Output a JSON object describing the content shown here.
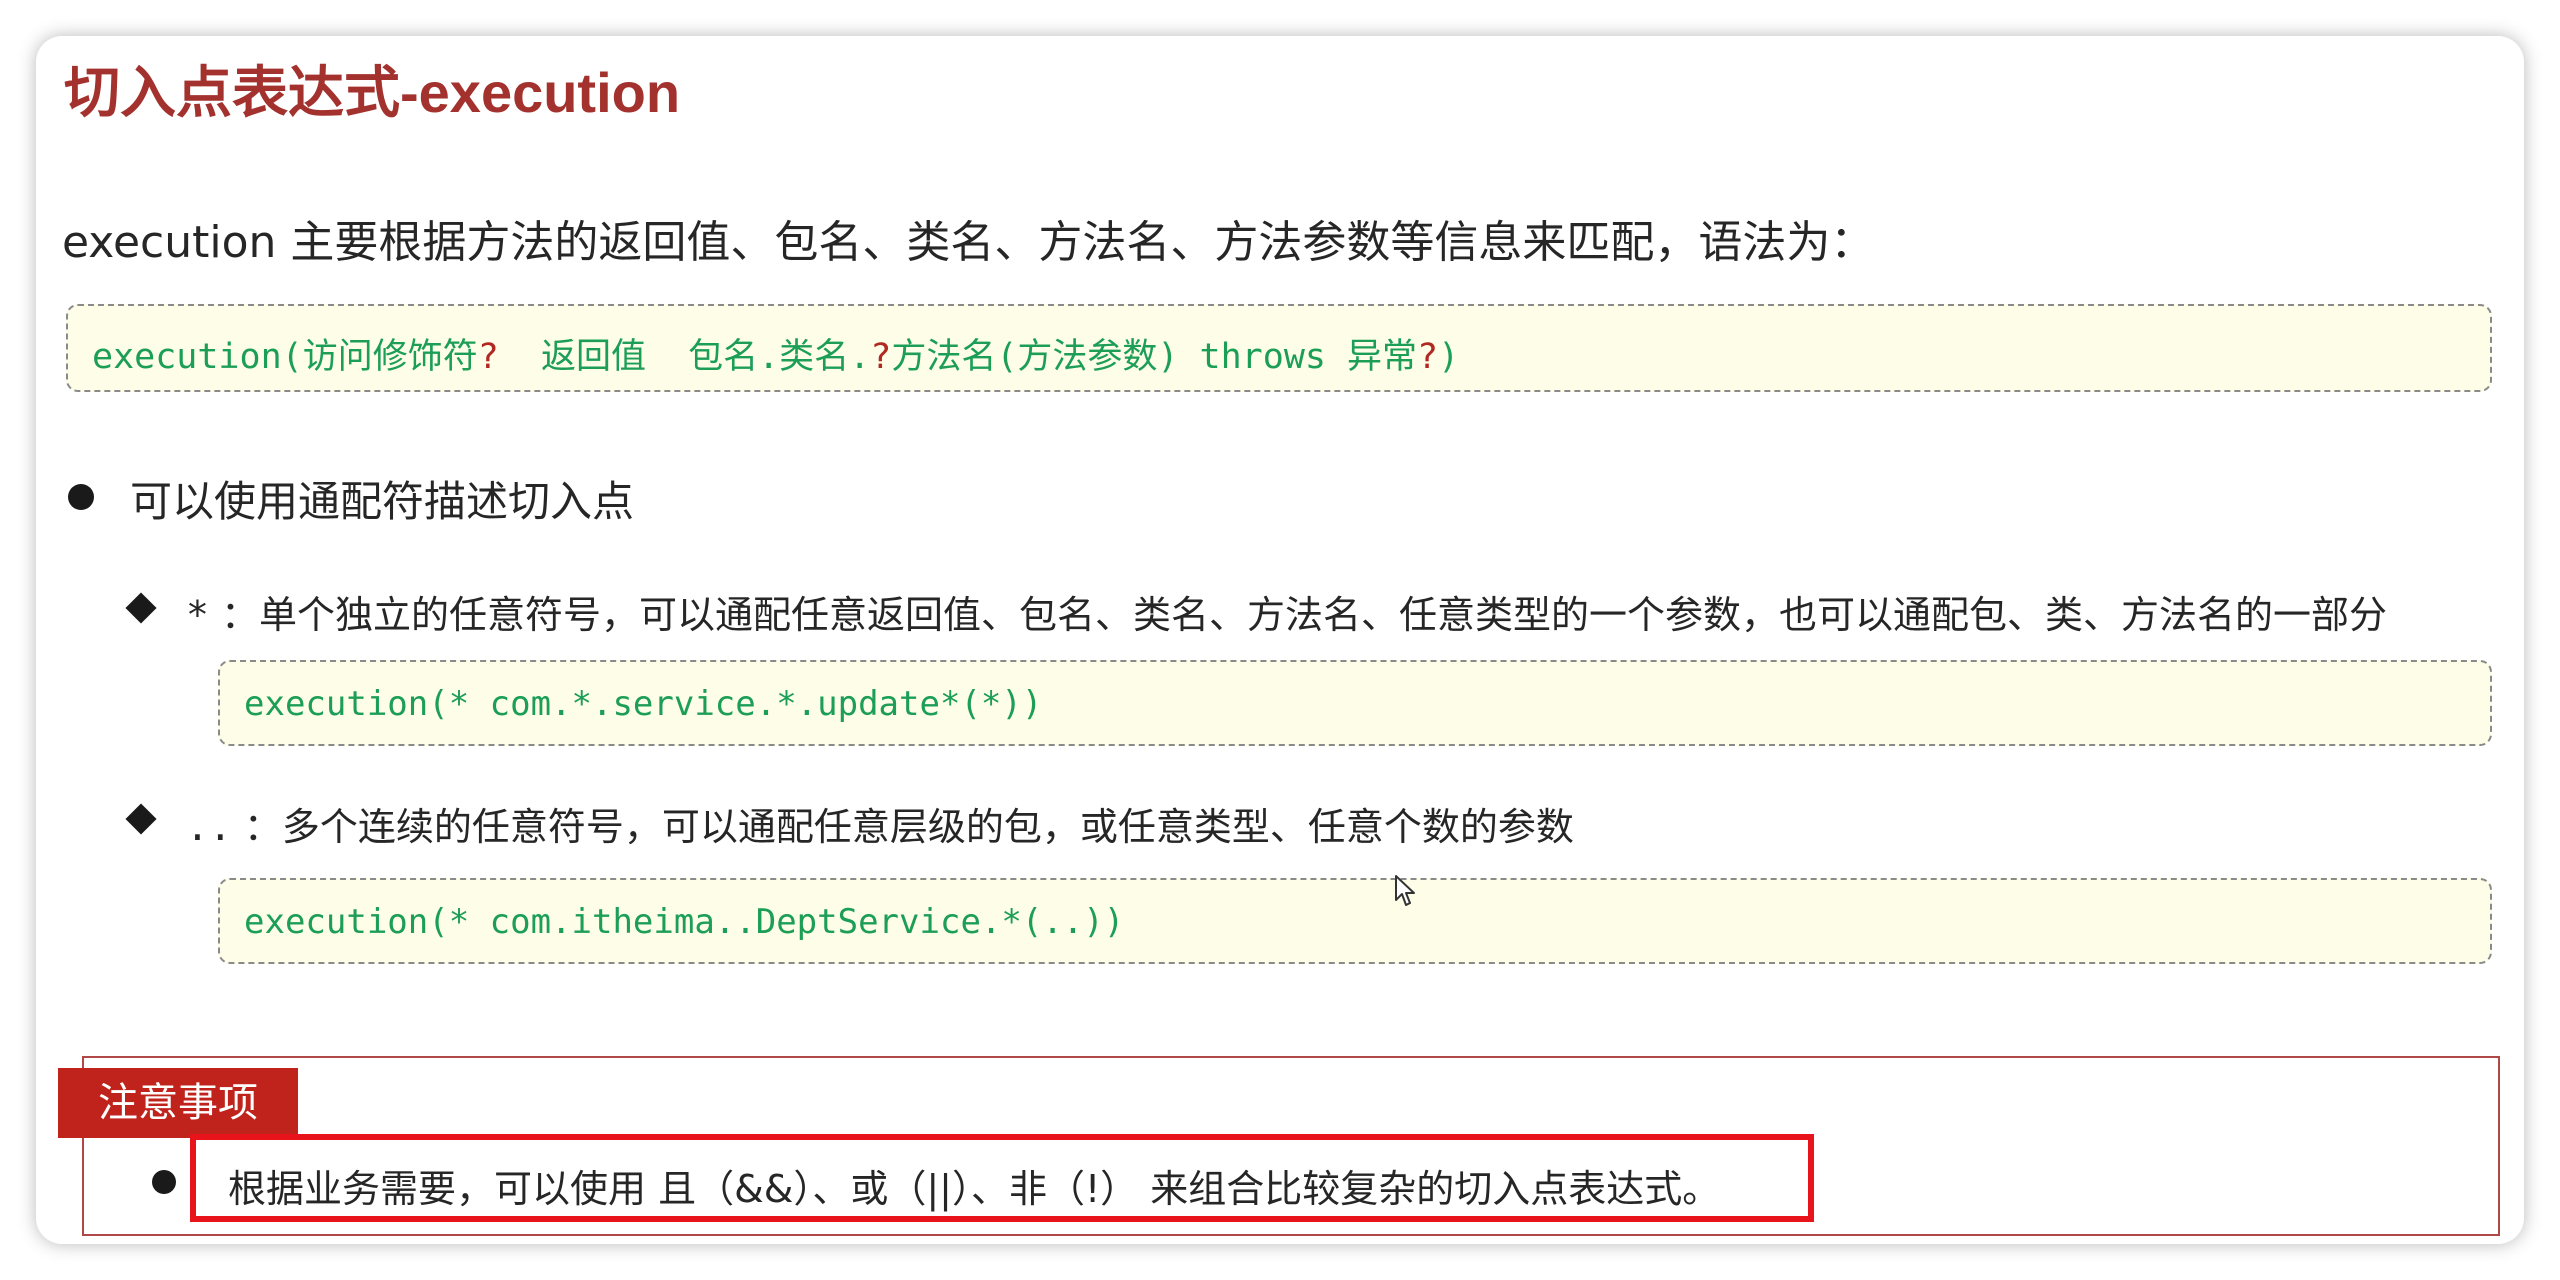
{
  "title": "切入点表达式-execution",
  "intro": "execution 主要根据方法的返回值、包名、类名、方法名、方法参数等信息来匹配，语法为：",
  "syntax": {
    "p1": "execution(访问修饰符",
    "q1": "?",
    "p2": "  返回值  包名.类名.",
    "q2": "?",
    "p3": "方法名(方法参数) throws 异常",
    "q3": "?",
    "p4": ")"
  },
  "wildcard": {
    "heading": "可以使用通配符描述切入点",
    "star": {
      "symbol": "*",
      "desc": "：单个独立的任意符号，可以通配任意返回值、包名、类名、方法名、任意类型的一个参数，也可以通配包、类、方法名的一部分",
      "example": "execution(* com.*.service.*.update*(*))"
    },
    "dots": {
      "symbol": "..",
      "desc": "：多个连续的任意符号，可以通配任意层级的包，或任意类型、任意个数的参数",
      "example": "execution(* com.itheima..DeptService.*(..))"
    }
  },
  "note": {
    "tag": "注意事项",
    "text": "根据业务需要，可以使用 且（&&）、或（||）、非（!） 来组合比较复杂的切入点表达式。"
  },
  "colors": {
    "title": "#a3322e",
    "code_text": "#1c9e57",
    "code_bg": "#fdfde8",
    "question_mark": "#b02822",
    "note_tag_bg": "#c0231c",
    "highlight_border": "#e8131b"
  },
  "icons": [
    "bullet-icon",
    "diamond-icon",
    "mouse-cursor-icon"
  ]
}
